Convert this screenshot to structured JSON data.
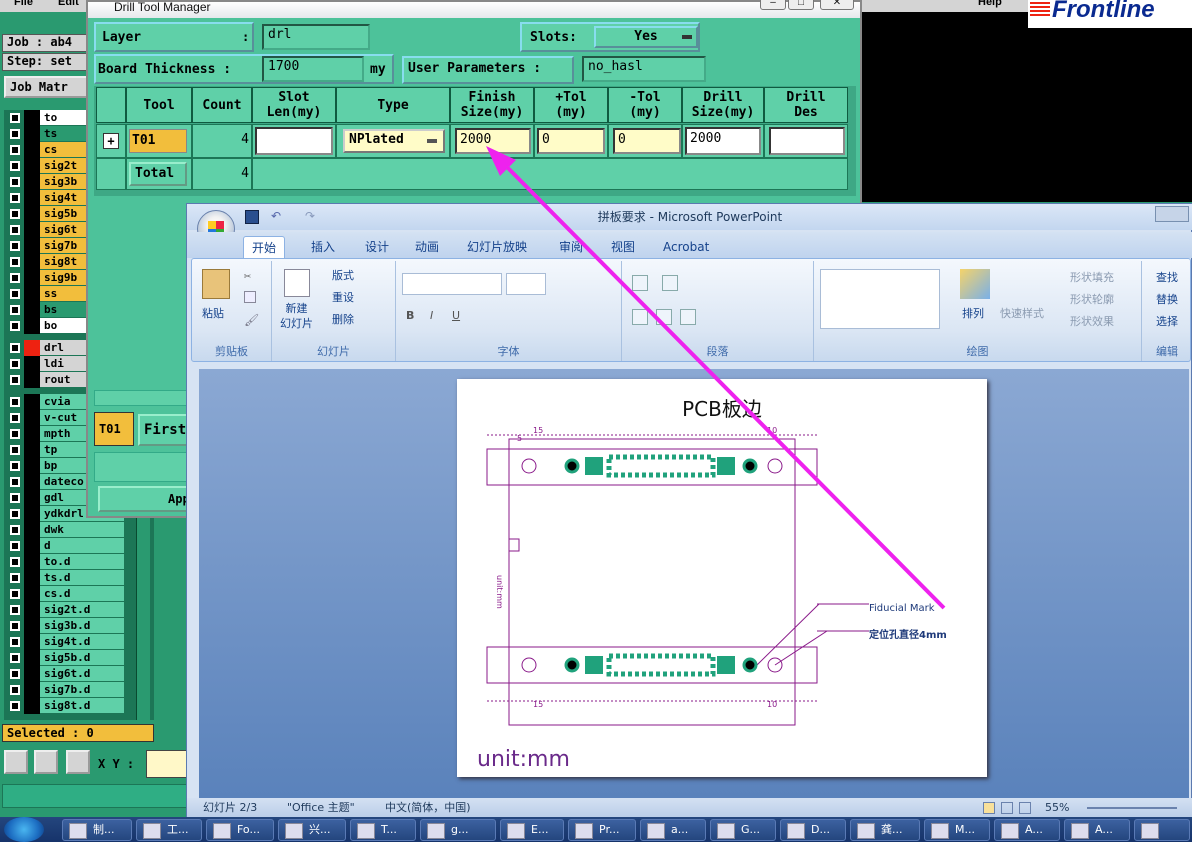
{
  "genesis": {
    "menu": [
      "File",
      "Edit"
    ],
    "help": "Help",
    "logo": "Frontline",
    "job_label": "Job : ab4",
    "step_label": "Step: set",
    "job_matrix_button": "Job Matr",
    "layers": [
      {
        "name": "to",
        "color": "#ffffff"
      },
      {
        "name": "ts",
        "color": "#2a9a70"
      },
      {
        "name": "cs",
        "color": "#f2be3c"
      },
      {
        "name": "sig2t",
        "color": "#f2be3c"
      },
      {
        "name": "sig3b",
        "color": "#f2be3c"
      },
      {
        "name": "sig4t",
        "color": "#f2be3c"
      },
      {
        "name": "sig5b",
        "color": "#f2be3c"
      },
      {
        "name": "sig6t",
        "color": "#f2be3c"
      },
      {
        "name": "sig7b",
        "color": "#f2be3c"
      },
      {
        "name": "sig8t",
        "color": "#f2be3c"
      },
      {
        "name": "sig9b",
        "color": "#f2be3c"
      },
      {
        "name": "ss",
        "color": "#f2be3c"
      },
      {
        "name": "bs",
        "color": "#2a9a70"
      },
      {
        "name": "bo",
        "color": "#ffffff"
      }
    ],
    "layers2": [
      {
        "name": "drl",
        "color": "#d4d4d4"
      },
      {
        "name": "ldi",
        "color": "#d4d4d4"
      },
      {
        "name": "rout",
        "color": "#d4d4d4"
      }
    ],
    "layers3": [
      "cvia",
      "v-cut",
      "mpth",
      "tp",
      "bp",
      "dateco",
      "gdl",
      "ydkdrl",
      "dwk",
      "d",
      "to.d",
      "ts.d",
      "cs.d",
      "sig2t.d",
      "sig3b.d",
      "sig4t.d",
      "sig5b.d",
      "sig6t.d",
      "sig7b.d",
      "sig8t.d"
    ],
    "selected": "Selected : 0",
    "xy_label": "X Y :"
  },
  "dtm": {
    "title": "Drill Tool Manager",
    "layer_label": "Layer",
    "layer_colon": ":",
    "layer_value": "drl",
    "slots_label": "Slots:",
    "slots_value": "Yes",
    "thickness_label": "Board Thickness :",
    "thickness_value": "1700",
    "thickness_unit": "my",
    "user_params_label": "User Parameters :",
    "user_params_value": "no_hasl",
    "columns": [
      "Tool",
      "Count",
      "Slot\nLen(my)",
      "Type",
      "Finish\nSize(my)",
      "+Tol\n(my)",
      "-Tol\n(my)",
      "Drill\nSize(my)",
      "Drill\nDes"
    ],
    "row": {
      "tool": "T01",
      "count": "4",
      "slot_len": "",
      "type": "NPlated",
      "finish": "2000",
      "ptol": "0",
      "mtol": "0",
      "drill": "2000",
      "des": ""
    },
    "total_label": "Total",
    "total_count": "4",
    "bottom_tool": "T01",
    "first_btn": "First",
    "apply_btn": "App"
  },
  "ppt": {
    "title": "拼板要求 - Microsoft PowerPoint",
    "tabs": [
      "开始",
      "插入",
      "设计",
      "动画",
      "幻灯片放映",
      "审阅",
      "视图",
      "Acrobat"
    ],
    "groups": [
      "剪贴板",
      "幻灯片",
      "字体",
      "段落",
      "绘图",
      "编辑"
    ],
    "paste": "粘贴",
    "new_slide": "新建\n幻灯片",
    "layout": "版式",
    "reset": "重设",
    "delete": "删除",
    "arrange": "排列",
    "quick_styles": "快速样式",
    "shape_fill": "形状填充",
    "shape_outline": "形状轮廓",
    "shape_effects": "形状效果",
    "find": "查找",
    "replace": "替换",
    "select": "选择",
    "slide_title": "PCB板边",
    "fiducial": "Fiducial Mark",
    "locating_hole": "定位孔直径4mm",
    "unit_vertical": "unit:mm",
    "unit": "unit:mm",
    "dims": {
      "d15": "15",
      "d5": "5",
      "d10": "10"
    },
    "status_slide": "幻灯片 2/3",
    "status_theme": "\"Office 主题\"",
    "status_lang": "中文(简体，中国)",
    "zoom": "55%"
  },
  "taskbar": {
    "items": [
      "制...",
      "工...",
      "Fo...",
      "兴...",
      "T...",
      "g...",
      "E...",
      "Pr...",
      "a...",
      "G...",
      "D...",
      "龚...",
      "M...",
      "A...",
      "A...",
      ""
    ]
  },
  "colors": {
    "genesis_bg": "#2a9a70",
    "dtm_bg": "#4dc29a",
    "input_yellow": "#fffcc8",
    "arrow": "#ee22ee",
    "accent_orange": "#f2be3c"
  }
}
